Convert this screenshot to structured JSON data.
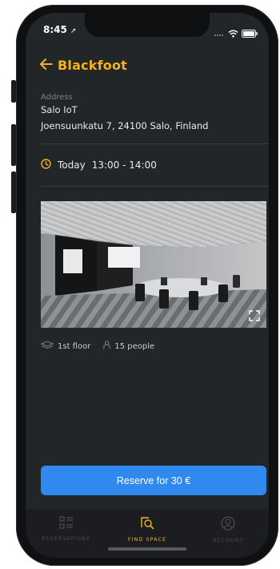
{
  "status": {
    "time": "8:45",
    "location_icon": "location-arrow-icon",
    "signal_icon": "signal-dots-icon",
    "wifi_icon": "wifi-icon",
    "battery_icon": "battery-icon"
  },
  "header": {
    "back_icon": "back-arrow-icon",
    "title": "Blackfoot"
  },
  "address": {
    "label": "Address",
    "name": "Salo IoT",
    "line": "Joensuunkatu 7, 24100 Salo, Finland"
  },
  "booking": {
    "icon": "clock-icon",
    "day": "Today",
    "time_range": "13:00 - 14:00"
  },
  "room": {
    "image_icon": "meeting-room-photo",
    "expand_icon": "fullscreen-icon",
    "floor_icon": "layers-icon",
    "floor": "1st floor",
    "capacity_icon": "person-icon",
    "capacity": "15 people"
  },
  "actions": {
    "reserve_label": "Reserve for 30 €"
  },
  "tabs": [
    {
      "label": "RESERVATIONS",
      "icon": "list-icon",
      "active": false
    },
    {
      "label": "FIND SPACE",
      "icon": "search-space-icon",
      "active": true
    },
    {
      "label": "ACCOUNT",
      "icon": "account-icon",
      "active": false
    }
  ],
  "colors": {
    "accent": "#f4b120",
    "button": "#2f89ef",
    "background": "#232629",
    "tabbar": "#1b1d20"
  }
}
